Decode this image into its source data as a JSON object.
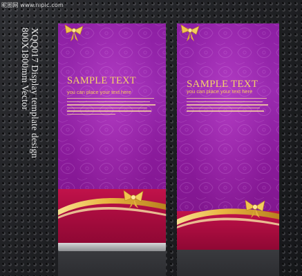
{
  "watermark": "昵图网 www.nipic.com",
  "side_caption": {
    "line1": "XQQ017 Display template design",
    "line2": "800X1800mm Vector"
  },
  "banners": [
    {
      "title": "SAMPLE TEXT",
      "subtitle": "you can place your text here"
    },
    {
      "title": "SAMPLE TEXT",
      "subtitle": "you can place your text here"
    }
  ],
  "colors": {
    "purple": "#8d1fa3",
    "crimson": "#b0103f",
    "gold": "#f2c85a",
    "background": "#202124"
  },
  "icons": [
    "ribbon-bow-icon",
    "gold-ribbon-icon"
  ]
}
